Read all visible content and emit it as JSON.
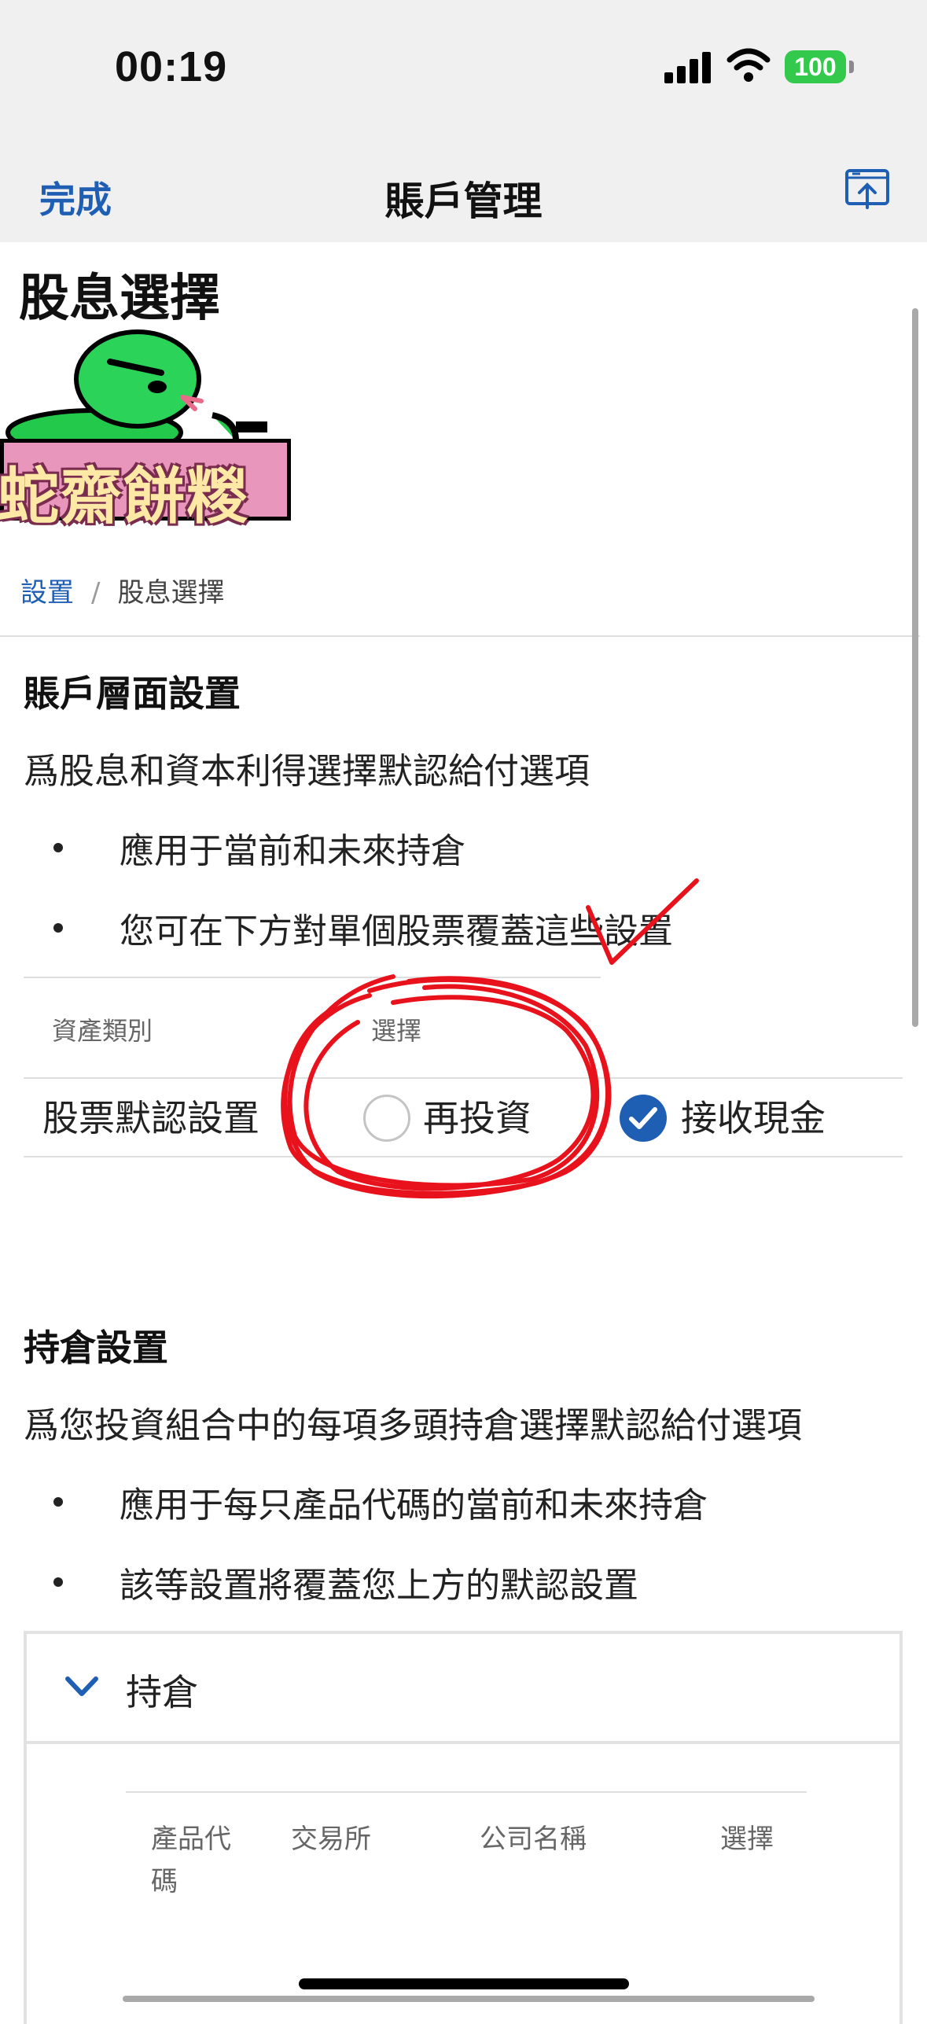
{
  "status_bar": {
    "time": "00:19",
    "battery": "100"
  },
  "nav": {
    "done_label": "完成",
    "title": "賬戶管理"
  },
  "page": {
    "title": "股息選擇",
    "logo_text": "蛇齋餅糉",
    "breadcrumb": {
      "parent": "設置",
      "separator": "/",
      "current": "股息選擇"
    }
  },
  "account_level": {
    "title": "賬戶層面設置",
    "description": "爲股息和資本利得選擇默認給付選項",
    "bullets": [
      "應用于當前和未來持倉",
      "您可在下方對單個股票覆蓋這些設置"
    ],
    "table": {
      "headers": [
        "資產類別",
        "選擇"
      ],
      "row_label": "股票默認設置",
      "options": [
        {
          "label": "再投資",
          "selected": false
        },
        {
          "label": "接收現金",
          "selected": true
        }
      ]
    }
  },
  "position_level": {
    "title": "持倉設置",
    "description": "爲您投資組合中的每項多頭持倉選擇默認給付選項",
    "bullets": [
      "應用于每只產品代碼的當前和未來持倉",
      "該等設置將覆蓋您上方的默認設置"
    ],
    "accordion_label": "持倉",
    "headers": [
      "產品代\n碼",
      "交易所",
      "公司名稱",
      "選擇"
    ]
  },
  "colors": {
    "accent": "#1f5fb3",
    "annotation": "#e8121c",
    "battery": "#33c94d",
    "logo_banner": "#e896bb"
  },
  "icons": [
    "signal-icon",
    "wifi-icon",
    "share-icon",
    "snake-icon",
    "checkmark-icon",
    "chevron-down-icon"
  ]
}
